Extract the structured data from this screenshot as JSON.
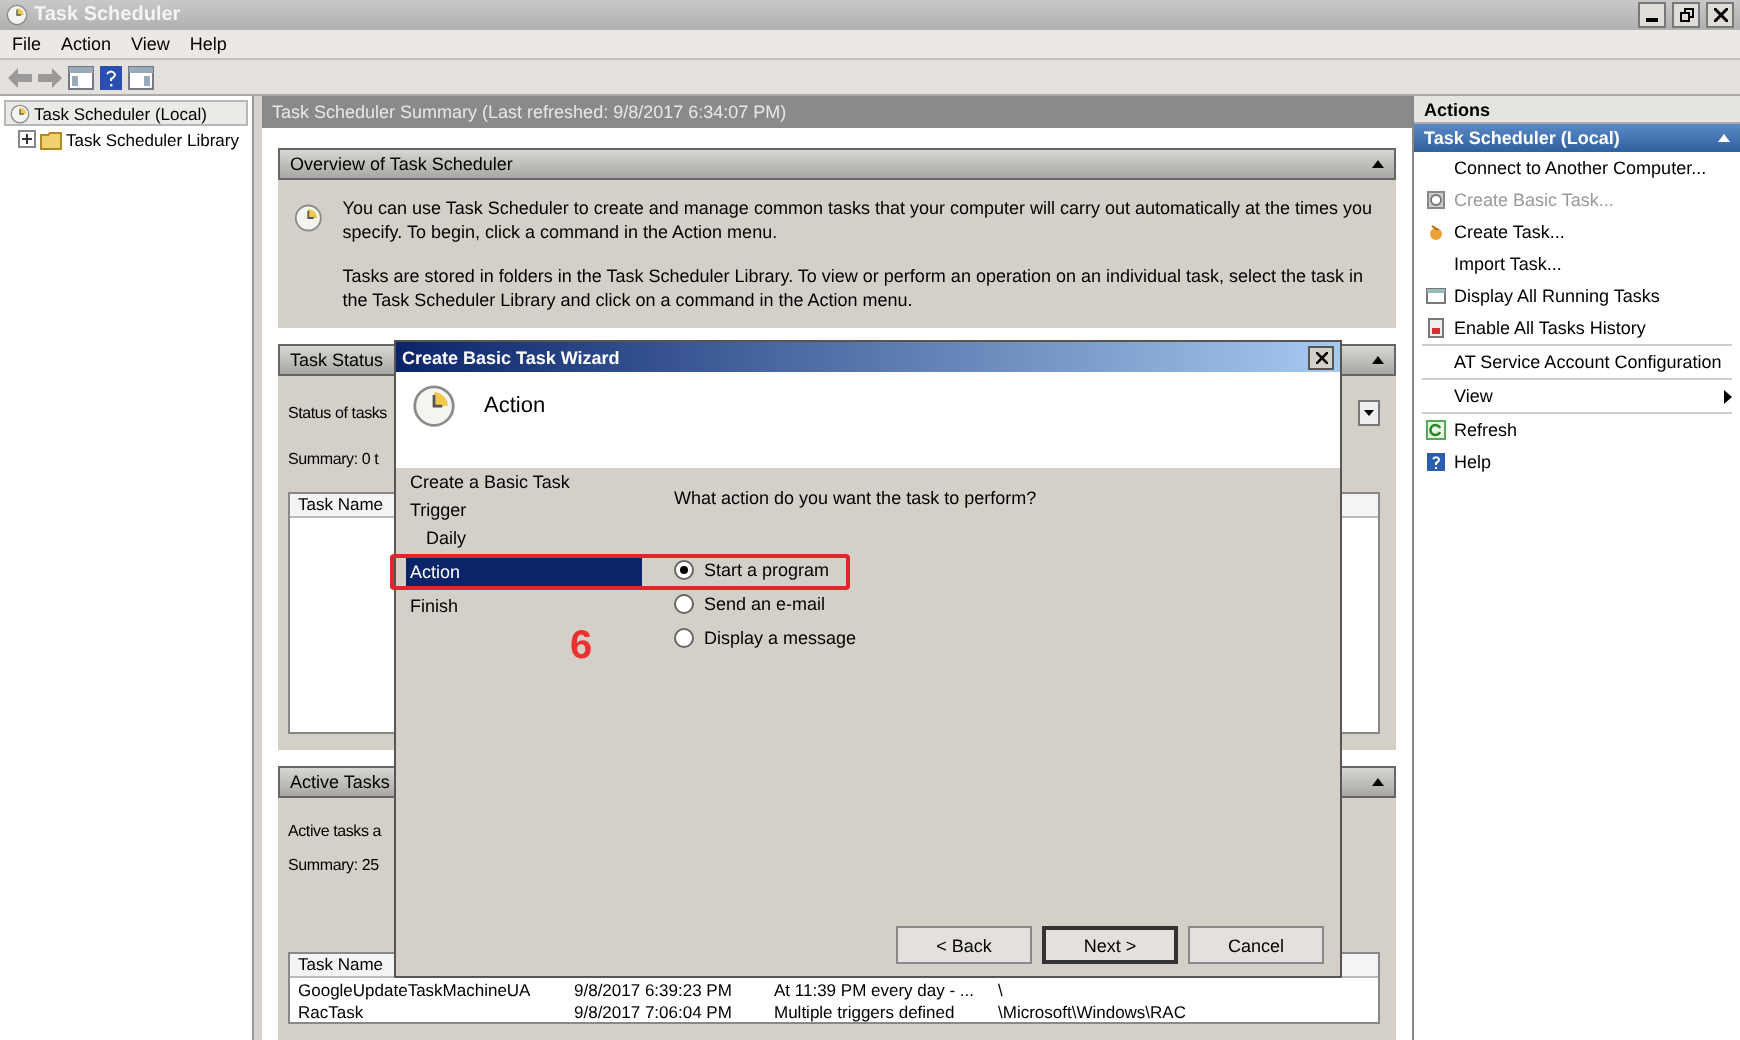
{
  "window": {
    "title": "Task Scheduler"
  },
  "menu": [
    "File",
    "Action",
    "View",
    "Help"
  ],
  "tree": [
    {
      "label": "Task Scheduler (Local)",
      "selected": true,
      "children": [
        {
          "label": "Task Scheduler Library",
          "selected": false,
          "expanded": false
        }
      ]
    }
  ],
  "summary": {
    "header": "Task Scheduler Summary (Last refreshed: 9/8/2017 6:34:07 PM)",
    "overview": {
      "title": "Overview of Task Scheduler",
      "paragraphs": [
        "You can use Task Scheduler to create and manage common tasks that your computer will carry out automatically at the times you specify. To begin, click a command in the Action menu.",
        "Tasks are stored in folders in the Task Scheduler Library. To view or perform an operation on an individual task, select the task in the Task Scheduler Library and click on a command in the Action menu."
      ]
    },
    "task_status": {
      "title": "Task Status",
      "status_label": "Status of tasks",
      "summary": "Summary: 0 t",
      "columns": [
        "Task Name"
      ]
    },
    "active_tasks": {
      "title": "Active Tasks",
      "label": "Active tasks a",
      "summary": "Summary: 25",
      "columns": [
        "Task Name"
      ],
      "rows": [
        [
          "GoogleUpdateTaskMachineUA",
          "9/8/2017 6:39:23 PM",
          "At 11:39 PM every day - ...",
          "\\"
        ],
        [
          "RacTask",
          "9/8/2017 7:06:04 PM",
          "Multiple triggers defined",
          "\\Microsoft\\Windows\\RAC"
        ]
      ]
    }
  },
  "actions": {
    "title": "Actions",
    "group": "Task Scheduler (Local)",
    "items": [
      {
        "kind": "item",
        "label": "Connect to Another Computer...",
        "disabled": false
      },
      {
        "kind": "item",
        "label": "Create Basic Task...",
        "disabled": true
      },
      {
        "kind": "item",
        "label": "Create Task...",
        "disabled": false
      },
      {
        "kind": "item",
        "label": "Import Task...",
        "disabled": false
      },
      {
        "kind": "item",
        "label": "Display All Running Tasks",
        "disabled": false
      },
      {
        "kind": "item",
        "label": "Enable All Tasks History",
        "disabled": false
      },
      {
        "kind": "separator"
      },
      {
        "kind": "item",
        "label": "AT Service Account Configuration",
        "disabled": false
      },
      {
        "kind": "separator"
      },
      {
        "kind": "submenu",
        "label": "View",
        "disabled": false
      },
      {
        "kind": "separator"
      },
      {
        "kind": "item",
        "label": "Refresh",
        "disabled": false
      },
      {
        "kind": "item",
        "label": "Help",
        "disabled": false
      }
    ]
  },
  "dialog": {
    "title": "Create Basic Task Wizard",
    "heading": "Action",
    "steps": [
      {
        "label": "Create a Basic Task",
        "selected": false
      },
      {
        "label": "Trigger",
        "selected": false,
        "children": [
          {
            "label": "Daily",
            "selected": false
          }
        ]
      },
      {
        "label": "Action",
        "selected": true
      },
      {
        "label": "Finish",
        "selected": false
      }
    ],
    "question": "What action do you want the task to perform?",
    "options": [
      {
        "label": "Start a program",
        "selected": true
      },
      {
        "label": "Send an e-mail",
        "selected": false
      },
      {
        "label": "Display a message",
        "selected": false
      }
    ],
    "buttons": [
      {
        "label": "< Back",
        "default": false
      },
      {
        "label": "Next >",
        "default": true
      },
      {
        "label": "Cancel",
        "default": false
      }
    ]
  },
  "annotation": {
    "label": "6"
  }
}
